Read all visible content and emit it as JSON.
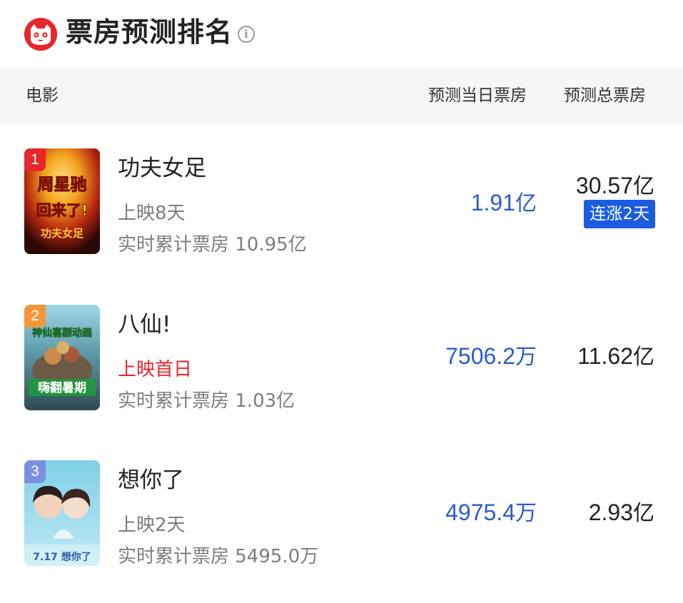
{
  "header": {
    "title": "票房预测排名",
    "info_icon": "info-icon"
  },
  "columns": {
    "movie": "电影",
    "daily": "预测当日票房",
    "total": "预测总票房"
  },
  "colors": {
    "brand": "#e8262b",
    "daily_value": "#2a5bd0",
    "streak_badge": "#1a5ce0",
    "header_bg": "#f6f6f6"
  },
  "movies": [
    {
      "rank": "1",
      "name": "功夫女足",
      "release": "上映8天",
      "cumulative": "实时累计票房 10.95亿",
      "daily_value": "1.91",
      "daily_unit": "亿",
      "total_value": "30.57",
      "total_unit": "亿",
      "badge": "连涨2天",
      "poster_text_top": "周星驰",
      "poster_text_mid": "回来了!",
      "poster_text_bottom": "功夫女足"
    },
    {
      "rank": "2",
      "name": "八仙!",
      "release": "上映首日",
      "cumulative": "实时累计票房 1.03亿",
      "daily_value": "7506.2",
      "daily_unit": "万",
      "total_value": "11.62",
      "total_unit": "亿",
      "poster_text_top": "神仙喜剧动画",
      "poster_text_bottom": "嗨翻暑期"
    },
    {
      "rank": "3",
      "name": "想你了",
      "release": "上映2天",
      "cumulative": "实时累计票房 5495.0万",
      "daily_value": "4975.4",
      "daily_unit": "万",
      "total_value": "2.93",
      "total_unit": "亿",
      "poster_text_bottom": "7.17 想你了"
    }
  ]
}
